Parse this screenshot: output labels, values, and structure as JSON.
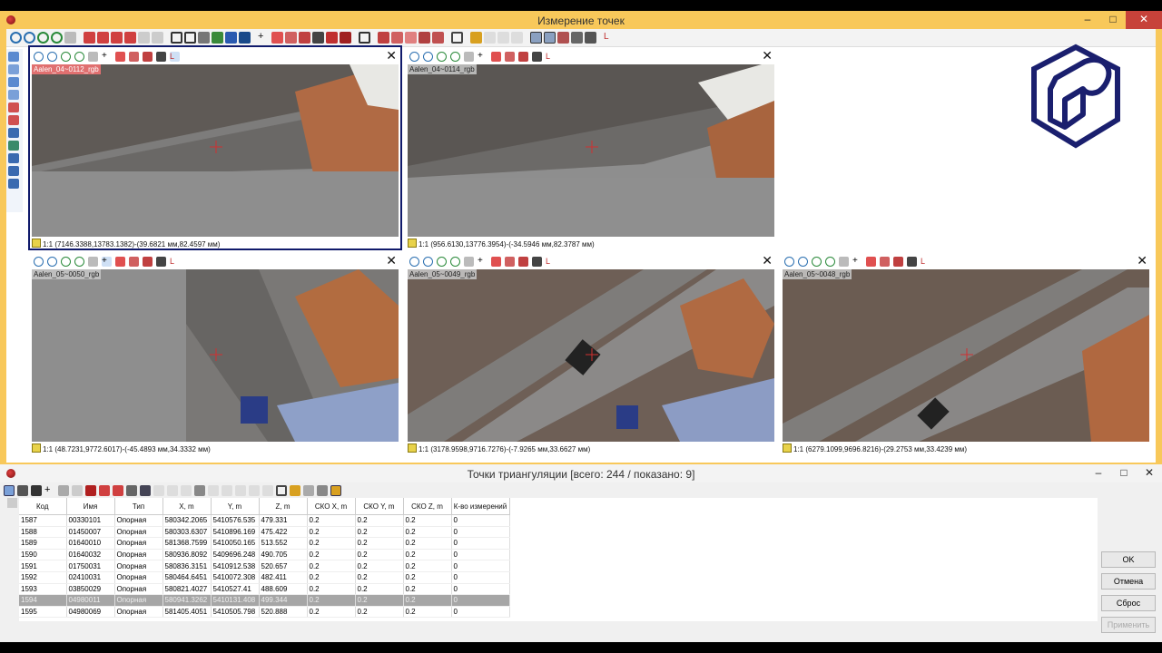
{
  "top_window": {
    "title": "Измерение точек",
    "controls": {
      "minimize": "–",
      "maximize": "□",
      "close": "✕"
    }
  },
  "panels": [
    {
      "name": "Aalen_04~0112_rgb",
      "status": "1:1 (7146.3388,13783.1382)-(39.6821 мм,82.4597 мм)",
      "active": true
    },
    {
      "name": "Aalen_04~0114_rgb",
      "status": "1:1 (956.6130,13776.3954)-(-34.5946 мм,82.3787 мм)",
      "active": false
    },
    {
      "name": "Aalen_05~0050_rgb",
      "status": "1:1 (48.7231,9772.6017)-(-45.4893 мм,34.3332 мм)",
      "active": false
    },
    {
      "name": "Aalen_05~0049_rgb",
      "status": "1:1 (3178.9598,9716.7276)-(-7.9265 мм,33.6627 мм)",
      "active": false
    },
    {
      "name": "Aalen_05~0048_rgb",
      "status": "1:1 (6279.1099,9696.8216)-(29.2753 мм,33.4239 мм)",
      "active": false
    }
  ],
  "panel_close": "✕",
  "bottom_window": {
    "title": "Точки триангуляции [всего: 244 / показано: 9]",
    "controls": {
      "minimize": "–",
      "maximize": "□",
      "close": "✕"
    },
    "columns": [
      "Код",
      "Имя",
      "Тип",
      "X, m",
      "Y, m",
      "Z, m",
      "СКО X, m",
      "СКО Y, m",
      "СКО Z, m",
      "К-во измерений"
    ],
    "rows": [
      [
        "1587",
        "00330101",
        "Опорная",
        "580342.2065",
        "5410576.535",
        "479.331",
        "0.2",
        "0.2",
        "0.2",
        "0"
      ],
      [
        "1588",
        "01450007",
        "Опорная",
        "580303.6307",
        "5410896.169",
        "475.422",
        "0.2",
        "0.2",
        "0.2",
        "0"
      ],
      [
        "1589",
        "01640010",
        "Опорная",
        "581368.7599",
        "5410050.165",
        "513.552",
        "0.2",
        "0.2",
        "0.2",
        "0"
      ],
      [
        "1590",
        "01640032",
        "Опорная",
        "580936.8092",
        "5409696.248",
        "490.705",
        "0.2",
        "0.2",
        "0.2",
        "0"
      ],
      [
        "1591",
        "01750031",
        "Опорная",
        "580836.3151",
        "5410912.538",
        "520.657",
        "0.2",
        "0.2",
        "0.2",
        "0"
      ],
      [
        "1592",
        "02410031",
        "Опорная",
        "580464.6451",
        "5410072.308",
        "482.411",
        "0.2",
        "0.2",
        "0.2",
        "0"
      ],
      [
        "1593",
        "03850029",
        "Опорная",
        "580821.4027",
        "5410527.41",
        "488.609",
        "0.2",
        "0.2",
        "0.2",
        "0"
      ],
      [
        "1594",
        "04980011",
        "Опорная",
        "580941.3262",
        "5410131.408",
        "499.344",
        "0.2",
        "0.2",
        "0.2",
        "0"
      ],
      [
        "1595",
        "04980069",
        "Опорная",
        "581405.4051",
        "5410505.798",
        "520.888",
        "0.2",
        "0.2",
        "0.2",
        "0"
      ]
    ],
    "selected_row": 7,
    "buttons": {
      "ok": "OK",
      "cancel": "Отмена",
      "reset": "Сброс",
      "apply": "Применить"
    }
  },
  "colors": {
    "top_title_bar": "#f8c85a",
    "active_frame": "#101a6b",
    "close_button": "#c7423a",
    "cross": "#d03030"
  }
}
